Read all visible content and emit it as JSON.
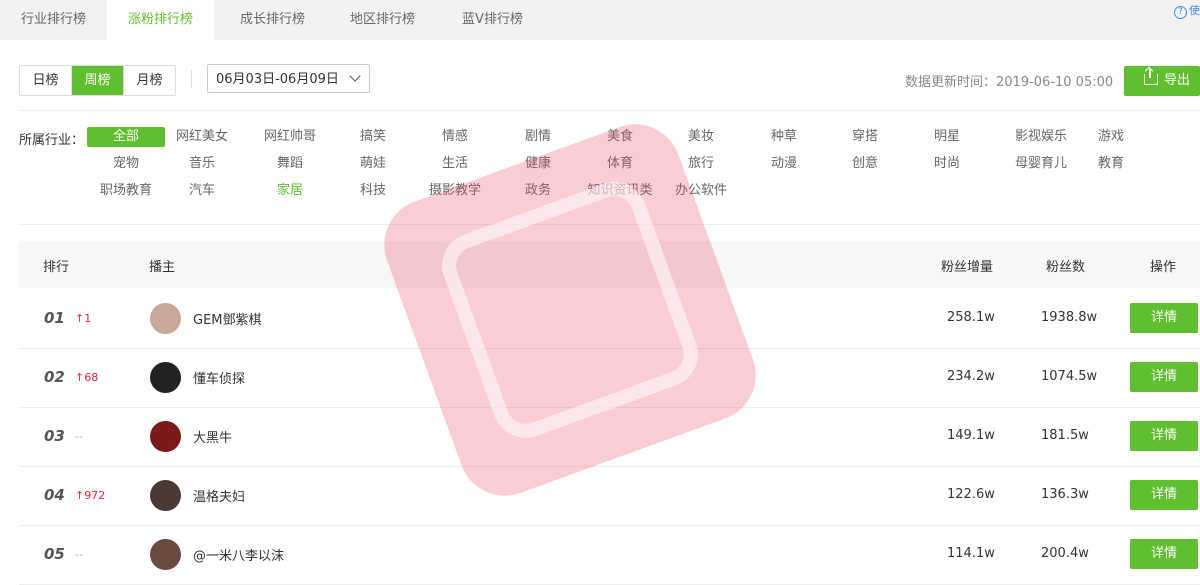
{
  "tabs": [
    "行业排行榜",
    "涨粉排行榜",
    "成长排行榜",
    "地区排行榜",
    "蓝V排行榜"
  ],
  "active_tab": 1,
  "help_text": "使",
  "periods": [
    "日榜",
    "周榜",
    "月榜"
  ],
  "active_period": 1,
  "date_range": "06月03日-06月09日",
  "update_time": "数据更新时间：2019-06-10 05:00",
  "export_label": "导出",
  "industry_label": "所属行业：",
  "industries": [
    "全部",
    "网红美女",
    "网红帅哥",
    "搞笑",
    "情感",
    "剧情",
    "美食",
    "美妆",
    "种草",
    "穿搭",
    "明星",
    "影视娱乐",
    "游戏",
    "宠物",
    "音乐",
    "舞蹈",
    "萌娃",
    "生活",
    "健康",
    "体育",
    "旅行",
    "动漫",
    "创意",
    "时尚",
    "母婴育儿",
    "教育",
    "职场教育",
    "汽车",
    "家居",
    "科技",
    "摄影教学",
    "政务",
    "知识资讯类",
    "办公软件"
  ],
  "table": {
    "headers": {
      "rank": "排行",
      "host": "播主",
      "gain": "粉丝增量",
      "fans": "粉丝数",
      "action": "操作"
    },
    "rows": [
      {
        "rank": "01",
        "change": "↑1",
        "name": "GEM鄧紫棋",
        "gain": "258.1w",
        "fans": "1938.8w",
        "action": "详情"
      },
      {
        "rank": "02",
        "change": "↑68",
        "name": "懂车侦探",
        "gain": "234.2w",
        "fans": "1074.5w",
        "action": "详情"
      },
      {
        "rank": "03",
        "change": "--",
        "name": "大黑牛",
        "gain": "149.1w",
        "fans": "181.5w",
        "action": "详情"
      },
      {
        "rank": "04",
        "change": "↑972",
        "name": "温格夫妇",
        "gain": "122.6w",
        "fans": "136.3w",
        "action": "详情"
      },
      {
        "rank": "05",
        "change": "--",
        "name": "@一米八李以沫",
        "gain": "114.1w",
        "fans": "200.4w",
        "action": "详情"
      }
    ]
  },
  "colors": {
    "accent": "#5fbf2f",
    "up": "#e22233",
    "watermark": "#e84a5a"
  }
}
